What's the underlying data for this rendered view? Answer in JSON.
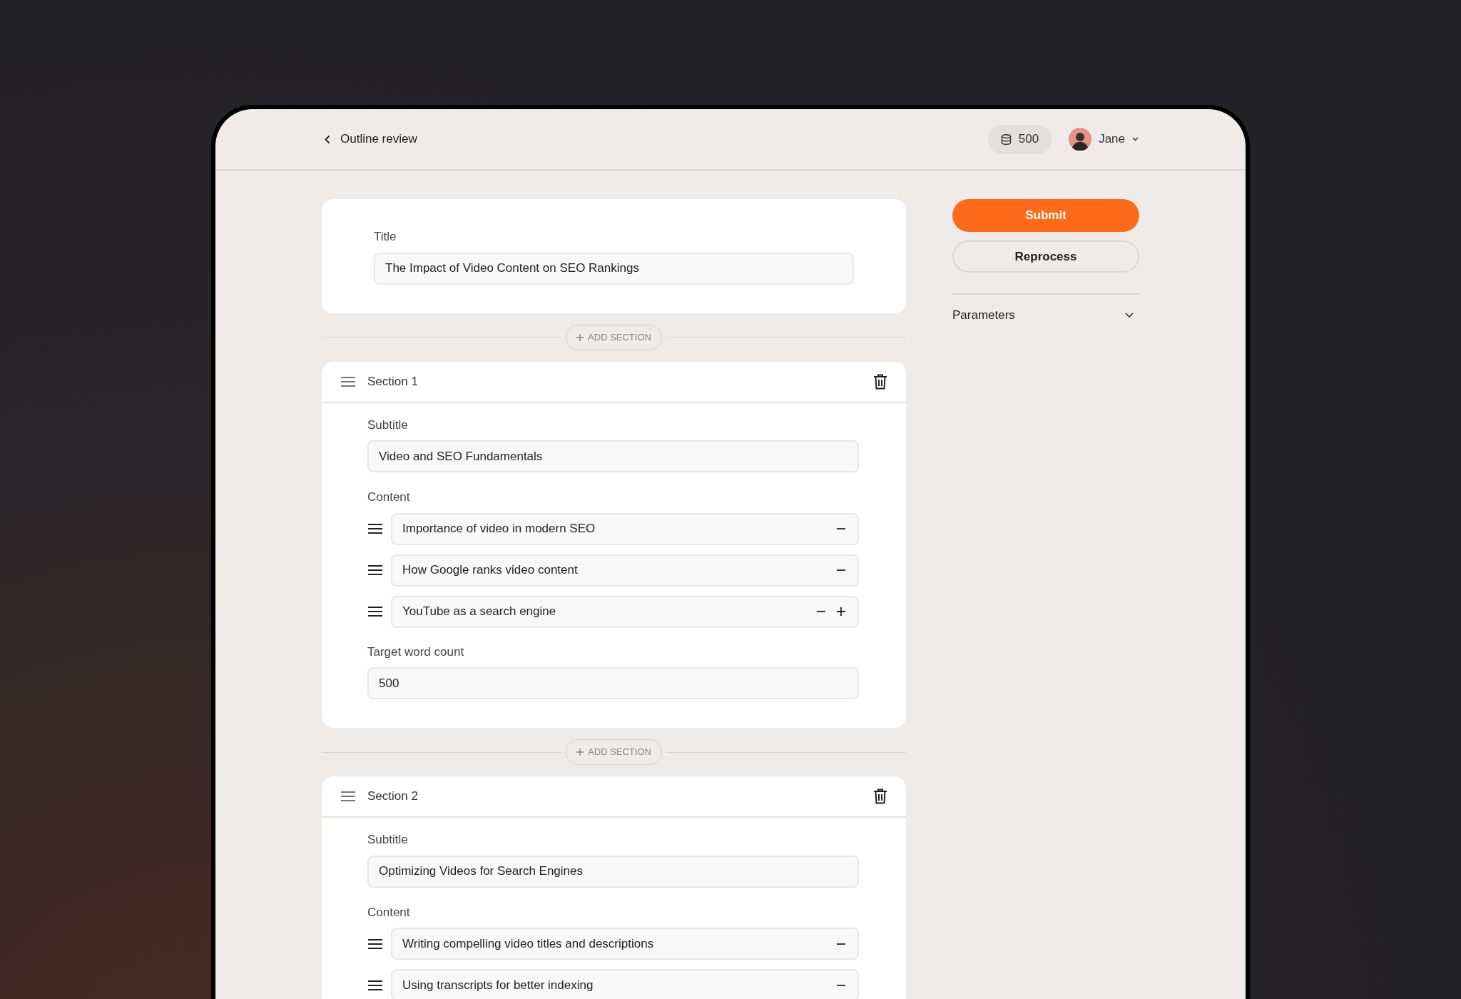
{
  "header": {
    "back_label": "Outline review",
    "credits": "500",
    "user_name": "Jane"
  },
  "title_card": {
    "label": "Title",
    "value": "The Impact of Video Content on SEO Rankings"
  },
  "sections": [
    {
      "add_section_label": "ADD SECTION",
      "title": "Section 1",
      "subtitle_label": "Subtitle",
      "subtitle": "Video and SEO Fundamentals",
      "content_label": "Content",
      "content_items": [
        {
          "text": "Importance of video in modern SEO",
          "kind": "item"
        },
        {
          "text": "How Google ranks video content",
          "kind": "item"
        },
        {
          "text": "YouTube as a search engine",
          "kind": "last"
        }
      ],
      "word_count_label": "Target word count",
      "word_count": "500"
    },
    {
      "add_section_label": "ADD SECTION",
      "title": "Section 2",
      "subtitle_label": "Subtitle",
      "subtitle": "Optimizing Videos for Search Engines",
      "content_label": "Content",
      "content_items": [
        {
          "text": "Writing compelling video titles and descriptions",
          "kind": "item"
        },
        {
          "text": "Using transcripts for better indexing",
          "kind": "item"
        }
      ]
    }
  ],
  "sidebar": {
    "submit": "Submit",
    "reprocess": "Reprocess",
    "parameters": {
      "label": "Parameters",
      "expanded": false
    }
  }
}
